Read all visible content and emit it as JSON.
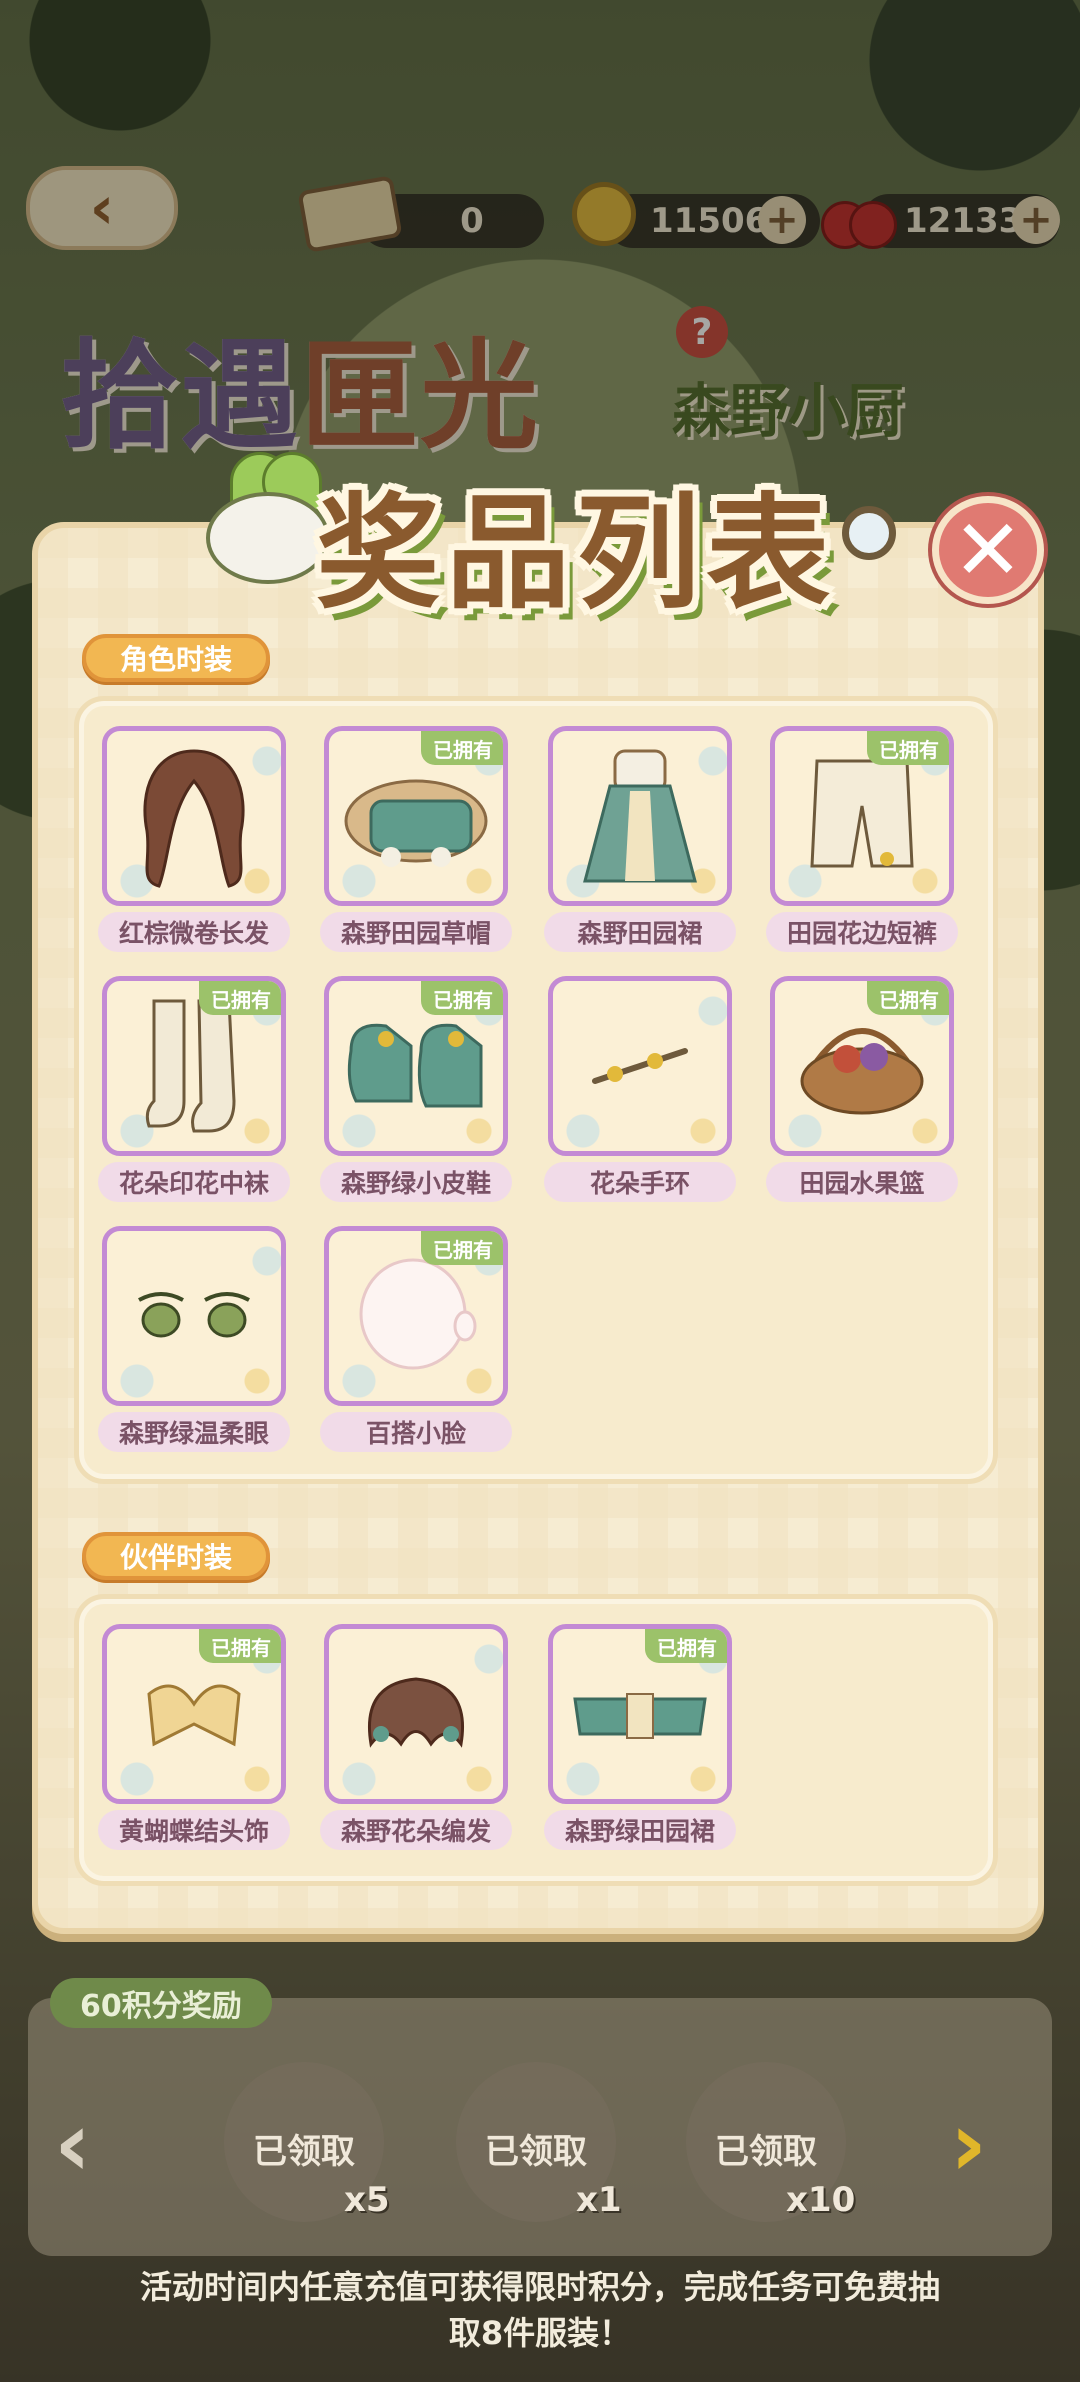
{
  "topbar": {
    "ticket_count": "0",
    "coin_count": "11506",
    "cherry_count": "12133"
  },
  "event": {
    "title_main": "拾遇",
    "title_accent": "匣光",
    "sub_logo": "森野小厨",
    "help": "?"
  },
  "modal": {
    "title": "奖品列表",
    "close": "✕"
  },
  "owned_badge": "已拥有",
  "sections": [
    {
      "label": "角色时装",
      "items": [
        {
          "name": "红棕微卷长发",
          "owned": false,
          "icon": "hair-icon"
        },
        {
          "name": "森野田园草帽",
          "owned": true,
          "icon": "hat-icon"
        },
        {
          "name": "森野田园裙",
          "owned": false,
          "icon": "dress-icon"
        },
        {
          "name": "田园花边短裤",
          "owned": true,
          "icon": "shorts-icon"
        },
        {
          "name": "花朵印花中袜",
          "owned": true,
          "icon": "socks-icon"
        },
        {
          "name": "森野绿小皮鞋",
          "owned": true,
          "icon": "shoes-icon"
        },
        {
          "name": "花朵手环",
          "owned": false,
          "icon": "bracelet-icon"
        },
        {
          "name": "田园水果篮",
          "owned": true,
          "icon": "basket-icon"
        },
        {
          "name": "森野绿温柔眼",
          "owned": false,
          "icon": "eyes-icon"
        },
        {
          "name": "百搭小脸",
          "owned": true,
          "icon": "face-icon"
        }
      ]
    },
    {
      "label": "伙伴时装",
      "items": [
        {
          "name": "黄蝴蝶结头饰",
          "owned": true,
          "icon": "bow-icon"
        },
        {
          "name": "森野花朵编发",
          "owned": false,
          "icon": "braid-icon"
        },
        {
          "name": "森野绿田园裙",
          "owned": true,
          "icon": "skirt-icon"
        }
      ]
    }
  ],
  "rewards": {
    "tag": "60积分奖励",
    "claimed": "已领取",
    "counts": [
      "x5",
      "x1",
      "x10"
    ]
  },
  "footer": {
    "line1": "活动时间内任意充值可获得限时积分，完成任务可免费抽",
    "line2": "取8件服装！"
  },
  "colors": {
    "accent": "#8a5a2e",
    "owned_badge": "#9cc26a",
    "close": "#e07a72",
    "section_tag": "#f2b752"
  }
}
